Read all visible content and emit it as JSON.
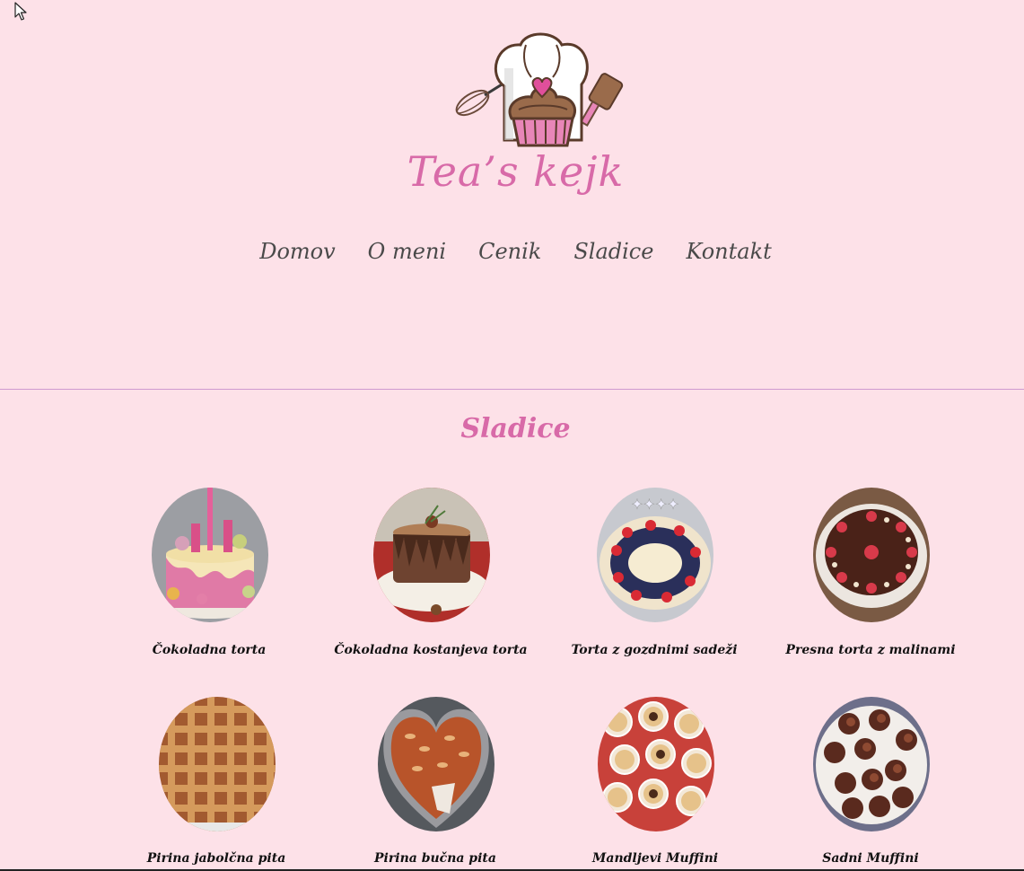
{
  "brand": {
    "name": "Tea’s kejk",
    "accent_color": "#d86aa8",
    "background_color": "#fde1e8"
  },
  "nav": {
    "items": [
      "Domov",
      "O meni",
      "Cenik",
      "Sladice",
      "Kontakt"
    ]
  },
  "section": {
    "title": "Sladice"
  },
  "desserts": [
    {
      "name": "Čokoladna torta",
      "image": "pink-cake"
    },
    {
      "name": "Čokoladna kostanjeva torta",
      "image": "chestnut-cake"
    },
    {
      "name": "Torta z gozdnimi sadeži",
      "image": "berry-cake"
    },
    {
      "name": "Presna torta z malinami",
      "image": "raspberry-tart"
    },
    {
      "name": "Pirina jabolčna pita",
      "image": "lattice-pie"
    },
    {
      "name": "Pirina bučna pita",
      "image": "heart-pie"
    },
    {
      "name": "Mandljevi Muffini",
      "image": "almond-muffins"
    },
    {
      "name": "Sadni Muffini",
      "image": "fruit-muffins"
    }
  ]
}
